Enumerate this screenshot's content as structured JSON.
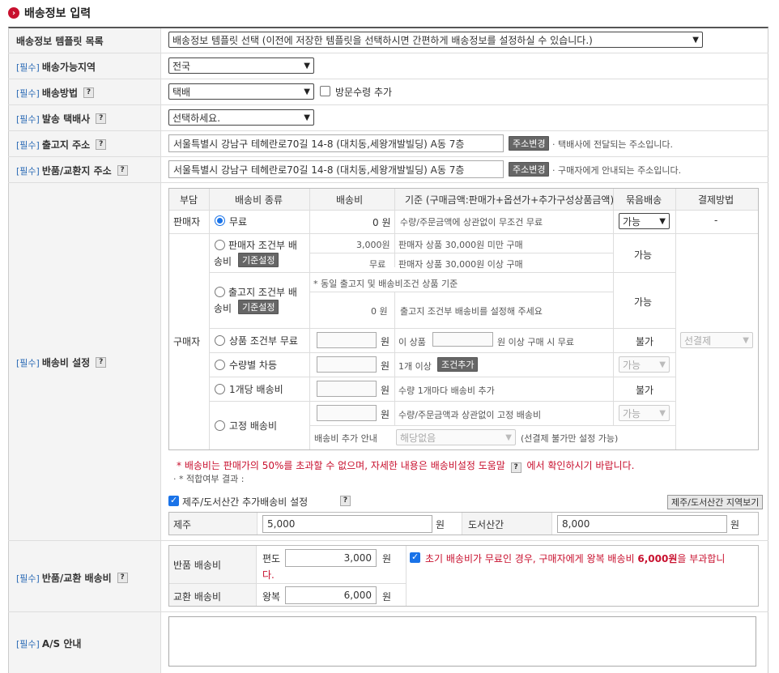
{
  "page_title": "배송정보 입력",
  "labels": {
    "template": "배송정보 템플릿 목록",
    "required": "[필수]",
    "region": "배송가능지역",
    "method": "배송방법",
    "courier": "발송 택배사",
    "ship_addr": "출고지 주소",
    "return_addr": "반품/교환지 주소",
    "fee": "배송비 설정",
    "return_fee": "반품/교환 배송비",
    "as": "A/S 안내"
  },
  "template_select": "배송정보 템플릿 선택 (이전에 저장한 템플릿을 선택하시면 간편하게 배송정보를 설정하실 수 있습니다.)",
  "region_select": "전국",
  "method_select": "택배",
  "visit_pickup_label": "방문수령 추가",
  "courier_select": "선택하세요.",
  "ship_address": "서울특별시 강남구 테헤란로70길 14-8 (대치동,세왕개발빌딩) A동 7층",
  "return_address": "서울특별시 강남구 테헤란로70길 14-8 (대치동,세왕개발빌딩) A동 7층",
  "addr_change_btn": "주소변경",
  "ship_addr_note": "· 택배사에 전달되는 주소입니다.",
  "return_addr_note": "· 구매자에게 안내되는 주소입니다.",
  "fee_table": {
    "headers": [
      "부담",
      "배송비 종류",
      "배송비",
      "기준 (구매금액:판매가+옵션가+추가구성상품금액)",
      "묶음배송",
      "결제방법"
    ],
    "seller": "판매자",
    "buyer": "구매자",
    "free_label": "무료",
    "free_amount": "0 원",
    "free_desc": "수량/주문금액에 상관없이 무조건 무료",
    "free_bundle": "가능",
    "free_payment": "-",
    "cond_label_1": "판매자 조건부 배",
    "cond_label_2": "송비",
    "std_btn": "기준설정",
    "cond_amount_1": "3,000원",
    "cond_desc_1": "판매자 상품 30,000원 미만 구매",
    "cond_amount_2": "무료",
    "cond_desc_2": "판매자 상품 30,000원 이상 구매",
    "cond_bundle": "가능",
    "ship_label_1": "출고지 조건부 배",
    "ship_label_2": "송비",
    "ship_note": "* 동일 출고지 및 배송비조건 상품 기준",
    "ship_amount": "0 원",
    "ship_desc": "출고지 조건부 배송비를 설정해 주세요",
    "ship_bundle": "가능",
    "prod_label": "상품 조건부 무료",
    "won": "원",
    "prod_desc_pre": "이 상품",
    "prod_desc_post": "원 이상 구매 시 무료",
    "prod_bundle": "불가",
    "payment_select": "선결제",
    "qty_label": "수량별 차등",
    "qty_desc": "1개 이상",
    "qty_btn": "조건추가",
    "qty_bundle": "가능",
    "per_label": "1개당 배송비",
    "per_desc": "수량 1개마다 배송비 추가",
    "per_bundle": "불가",
    "fixed_label": "고정 배송비",
    "fixed_desc": "수량/주문금액과 상관없이 고정 배송비",
    "fixed_bundle": "가능",
    "guide_label": "배송비 추가 안내",
    "guide_select": "해당없음",
    "guide_note": "(선결제 불가만 설정 가능)"
  },
  "fee_warning_1": "* 배송비는 판매가의 50%를 초과할 수 없으며, 자세한 내용은 배송비설정 도움말",
  "fee_warning_2": "에서 확인하시기 바랍니다.",
  "fee_result": "· * 적합여부 결과 :",
  "island_check_label": "제주/도서산간 추가배송비 설정",
  "island_btn": "제주/도서산간 지역보기",
  "jeju_label": "제주",
  "jeju_value": "5,000",
  "island_label": "도서산간",
  "island_value": "8,000",
  "return_fee": {
    "return_label": "반품 배송비",
    "one_way": "편도",
    "return_value": "3,000",
    "exchange_label": "교환 배송비",
    "round_trip": "왕복",
    "exchange_value": "6,000",
    "notice_pre": "초기 배송비가 무료인 경우, 구매자에게 왕복 배송비 ",
    "notice_bold": "6,000원",
    "notice_post": "을 부과합니",
    "notice_end": "다."
  }
}
